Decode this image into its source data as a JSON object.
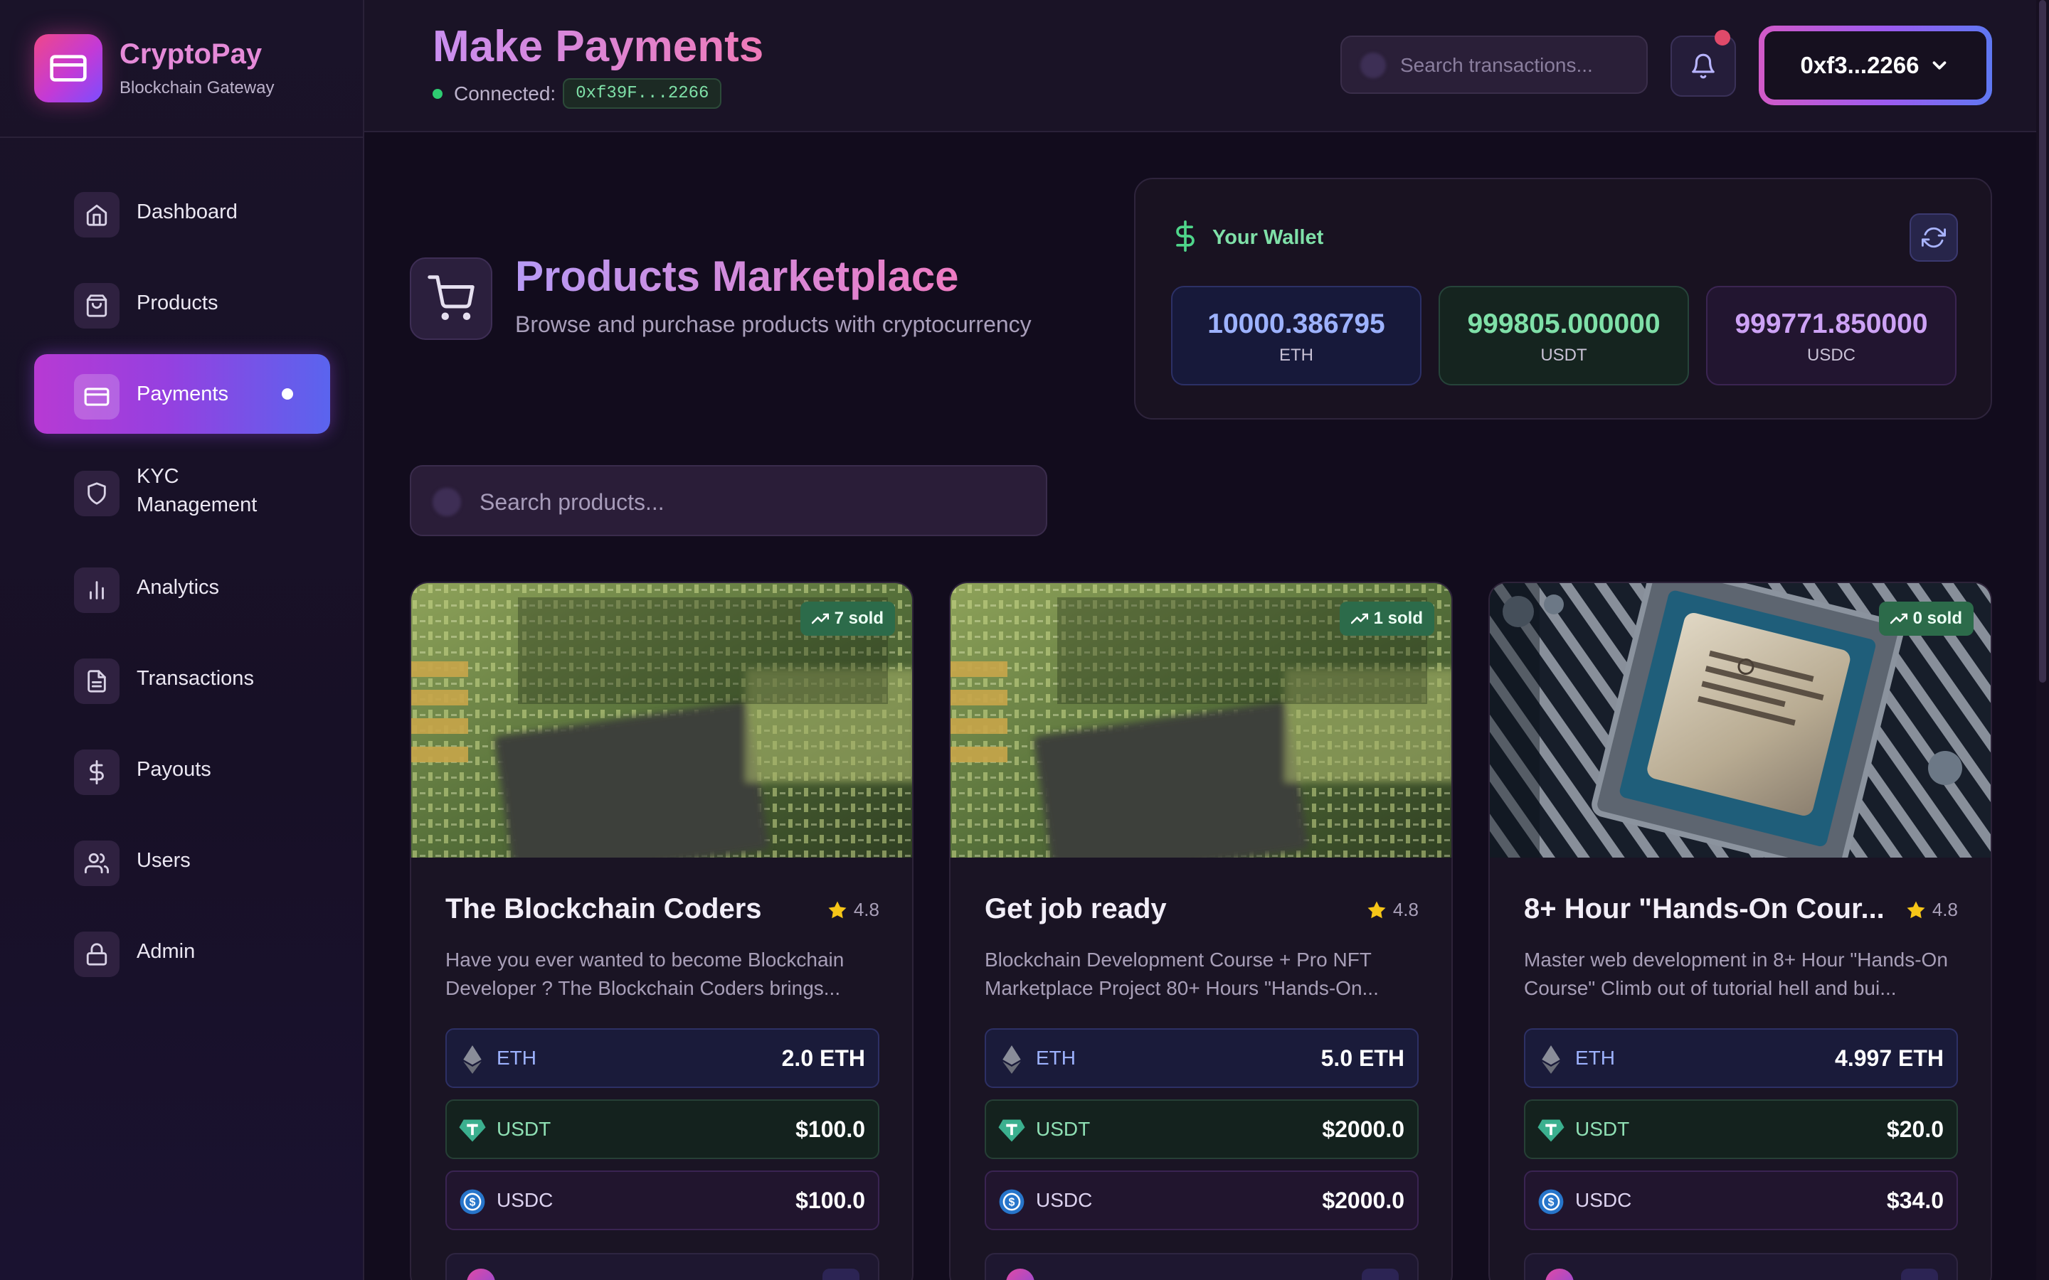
{
  "brand": {
    "name": "CryptoPay",
    "subtitle": "Blockchain Gateway"
  },
  "sidebar": {
    "items": [
      {
        "label": "Dashboard",
        "icon": "home-icon",
        "active": false
      },
      {
        "label": "Products",
        "icon": "shopping-bag-icon",
        "active": false
      },
      {
        "label": "Payments",
        "icon": "credit-card-icon",
        "active": true
      },
      {
        "label": "KYC Management",
        "icon": "shield-icon",
        "active": false
      },
      {
        "label": "Analytics",
        "icon": "bar-chart-icon",
        "active": false
      },
      {
        "label": "Transactions",
        "icon": "file-text-icon",
        "active": false
      },
      {
        "label": "Payouts",
        "icon": "dollar-sign-icon",
        "active": false
      },
      {
        "label": "Users",
        "icon": "users-icon",
        "active": false
      },
      {
        "label": "Admin",
        "icon": "lock-icon",
        "active": false
      }
    ]
  },
  "header": {
    "title": "Make Payments",
    "connected_label": "Connected:",
    "connected_address": "0xf39F...2266",
    "search_placeholder": "Search transactions...",
    "wallet_button": "0xf3...2266"
  },
  "marketplace": {
    "title": "Products Marketplace",
    "subtitle": "Browse and purchase products with cryptocurrency",
    "search_placeholder": "Search products..."
  },
  "wallet": {
    "title": "Your Wallet",
    "balances": [
      {
        "value": "10000.386795",
        "currency": "ETH"
      },
      {
        "value": "999805.000000",
        "currency": "USDT"
      },
      {
        "value": "999771.850000",
        "currency": "USDC"
      }
    ]
  },
  "products": [
    {
      "title": "The Blockchain Coders",
      "rating": "4.8",
      "sold": "7 sold",
      "description": "Have you ever wanted to become Blockchain Developer ? The Blockchain Coders brings...",
      "prices": [
        {
          "currency": "ETH",
          "amount": "2.0 ETH"
        },
        {
          "currency": "USDT",
          "amount": "$100.0"
        },
        {
          "currency": "USDC",
          "amount": "$100.0"
        }
      ]
    },
    {
      "title": "Get job ready",
      "rating": "4.8",
      "sold": "1 sold",
      "description": "Blockchain Development Course + Pro NFT Marketplace Project 80+ Hours \"Hands-On...",
      "prices": [
        {
          "currency": "ETH",
          "amount": "5.0 ETH"
        },
        {
          "currency": "USDT",
          "amount": "$2000.0"
        },
        {
          "currency": "USDC",
          "amount": "$2000.0"
        }
      ]
    },
    {
      "title": "8+ Hour \"Hands-On Cour...",
      "rating": "4.8",
      "sold": "0 sold",
      "description": "Master web development in 8+ Hour \"Hands-On Course\" Climb out of tutorial hell and bui...",
      "prices": [
        {
          "currency": "ETH",
          "amount": "4.997 ETH"
        },
        {
          "currency": "USDT",
          "amount": "$20.0"
        },
        {
          "currency": "USDC",
          "amount": "$34.0"
        }
      ]
    }
  ],
  "colors": {
    "accent_pink": "#e058c8",
    "accent_purple": "#9540e0",
    "accent_blue": "#5a64ee",
    "success": "#2ecc71",
    "bg": "#120c1d"
  }
}
